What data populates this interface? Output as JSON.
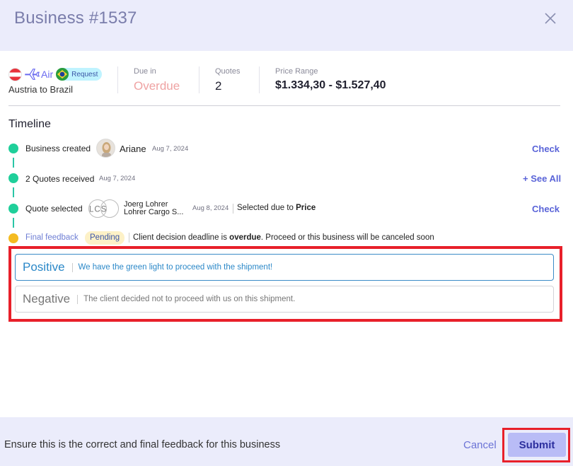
{
  "modal": {
    "title": "Business #1537"
  },
  "icons": {
    "close": "close-icon",
    "plane": "plane-icon",
    "flag_origin": "austria-flag-icon",
    "flag_dest": "brazil-flag-icon"
  },
  "summary": {
    "mode": "Air",
    "badge": "Request",
    "route": "Austria to Brazil",
    "due_label": "Due in",
    "due_value": "Overdue",
    "quotes_label": "Quotes",
    "quotes_value": "2",
    "price_label": "Price Range",
    "price_value": "$1.334,30 - $1.527,40"
  },
  "timeline": {
    "title": "Timeline",
    "created": {
      "label": "Business created",
      "user": "Ariane",
      "date": "Aug 7, 2024",
      "action": "Check"
    },
    "quotes": {
      "label": "2 Quotes received",
      "date": "Aug 7, 2024",
      "action": "+ See All"
    },
    "selected": {
      "label": "Quote selected",
      "logo_text": "LCS",
      "contact": "Joerg Lohrer",
      "company": "Lohrer Cargo S...",
      "date": "Aug 8, 2024",
      "reason_prefix": "Selected due to ",
      "reason_value": "Price",
      "action": "Check"
    },
    "final": {
      "label": "Final feedback",
      "status": "Pending",
      "msg_prefix": "Client decision deadline is ",
      "msg_emph": "overdue",
      "msg_suffix": ". Proceed or this business will be canceled soon"
    }
  },
  "options": [
    {
      "name": "Positive",
      "desc": "We have the green light to proceed with the shipment!"
    },
    {
      "name": "Negative",
      "desc": "The client decided not to proceed with us on this shipment."
    }
  ],
  "footer": {
    "note": "Ensure this is the correct and final feedback for this business",
    "cancel": "Cancel",
    "submit": "Submit"
  },
  "colors": {
    "accent": "#6b73d6",
    "success": "#1fcf9a",
    "pending": "#f4bb21",
    "highlight": "#e8202a",
    "overdue": "#efa3a3"
  }
}
